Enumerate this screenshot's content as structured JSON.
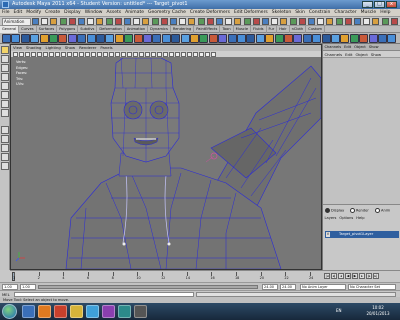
{
  "window": {
    "title": "Autodesk Maya 2011 x64 - Student Version: untitled* --- Target_pivot1"
  },
  "menubar": {
    "items": [
      "File",
      "Edit",
      "Modify",
      "Create",
      "Display",
      "Window",
      "Assets",
      "Animate",
      "Geometry Cache",
      "Create Deformers",
      "Edit Deformers",
      "Skeleton",
      "Skin",
      "Constrain",
      "Character",
      "Muscle",
      "Help"
    ]
  },
  "statusline": {
    "mode": "Animation"
  },
  "shelf": {
    "tabs": [
      "General",
      "Curves",
      "Surfaces",
      "Polygons",
      "Subdivs",
      "Deformation",
      "Animation",
      "Dynamics",
      "Rendering",
      "PaintEffects",
      "Toon",
      "Muscle",
      "Fluids",
      "Fur",
      "Hair",
      "nCloth",
      "Custom"
    ],
    "active_tab": 0
  },
  "viewport": {
    "menu": [
      "View",
      "Shading",
      "Lighting",
      "Show",
      "Renderer",
      "Panels"
    ],
    "hud": [
      {
        "label": "Verts:",
        "a": "",
        "b": ""
      },
      {
        "label": "Edges:",
        "a": "",
        "b": ""
      },
      {
        "label": "Faces:",
        "a": "",
        "b": ""
      },
      {
        "label": "Tris:",
        "a": "",
        "b": ""
      },
      {
        "label": "UVs:",
        "a": "",
        "b": ""
      }
    ]
  },
  "channelbox": {
    "tabs": [
      "Channels",
      "Edit",
      "Object",
      "Show"
    ],
    "menu": [
      "Channels",
      "Edit",
      "Object",
      "Show"
    ],
    "layer_modes": [
      "Display",
      "Render",
      "Anim"
    ],
    "layer_menu": [
      "Layers",
      "Options",
      "Help"
    ],
    "layer": {
      "visible": "V",
      "name": "Target_pivot1Layer"
    }
  },
  "timeslider": {
    "ticks": [
      "1",
      "2",
      "4",
      "6",
      "8",
      "10",
      "12",
      "14",
      "16",
      "18",
      "20",
      "22",
      "24"
    ],
    "current": "1.00"
  },
  "rangeslider": {
    "start": "1.00",
    "end": "24.00",
    "anim_layer": "No Anim Layer",
    "char_set": "No Character Set"
  },
  "cmdline": {
    "label": "MEL"
  },
  "helpline": {
    "text": "Move Tool: Select an object to move."
  },
  "taskbar": {
    "time": "10:02",
    "date": "20/01/2013",
    "tray": "EN"
  },
  "colors": {
    "wireframe": "#2a2ad8",
    "mesh": "#7a7a7a",
    "viewport_bg": "#777777",
    "selection": "#2f5f9f"
  }
}
